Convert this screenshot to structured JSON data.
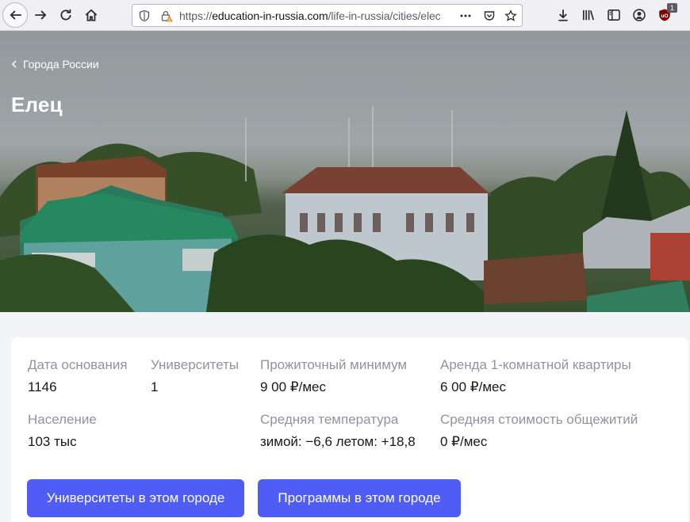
{
  "browser": {
    "url_prefix": "https://",
    "url_host": "education-in-russia.com",
    "url_path": "/life-in-russia/cities/elec",
    "ublock_count": "1"
  },
  "hero": {
    "breadcrumb": "Города России",
    "title": "Елец"
  },
  "facts": {
    "founded_label": "Дата основания",
    "founded_value": "1146",
    "universities_label": "Университеты",
    "universities_value": "1",
    "living_wage_label": "Прожиточный минимум",
    "living_wage_value": "9 00 ₽/мес",
    "rent_label": "Аренда 1-комнатной квартиры",
    "rent_value": "6 00 ₽/мес",
    "population_label": "Население",
    "population_value": "103 тыс",
    "temperature_label": "Средняя температура",
    "temperature_value": "зимой: −6,6 летом: +18,8",
    "dorm_label": "Средняя стоимость общежитий",
    "dorm_value": "0 ₽/мес"
  },
  "actions": {
    "universities_button": "Университеты в этом городе",
    "programs_button": "Программы в этом городе"
  },
  "colors": {
    "accent": "#4f5cf5",
    "label": "#8f93a3",
    "value": "#17181c"
  }
}
